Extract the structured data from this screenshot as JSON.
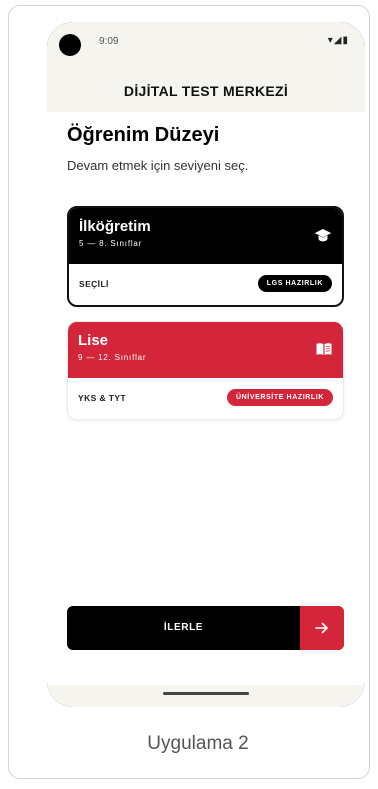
{
  "status": {
    "time": "9:09"
  },
  "header": {
    "title": "DİJİTAL TEST MERKEZİ"
  },
  "main": {
    "title": "Öğrenim Düzeyi",
    "subtitle": "Devam etmek için seviyeni seç.",
    "levels": [
      {
        "name": "İlköğretim",
        "range": "5 — 8. Sınıflar",
        "icon": "graduation-cap-icon",
        "footer_label": "SEÇİLİ",
        "badge": "LGS HAZIRLIK",
        "selected": true,
        "color": "#000000"
      },
      {
        "name": "Lise",
        "range": "9 — 12. Sınıflar",
        "icon": "book-icon",
        "footer_label": "YKS & TYT",
        "badge": "ÜNİVERSİTE HAZIRLIK",
        "selected": false,
        "color": "#d4263a"
      }
    ],
    "continue_label": "İLERLE"
  },
  "caption": "Uygulama 2",
  "colors": {
    "accent": "#d4263a",
    "dark": "#000000",
    "header_bg": "#f6f4ef"
  }
}
